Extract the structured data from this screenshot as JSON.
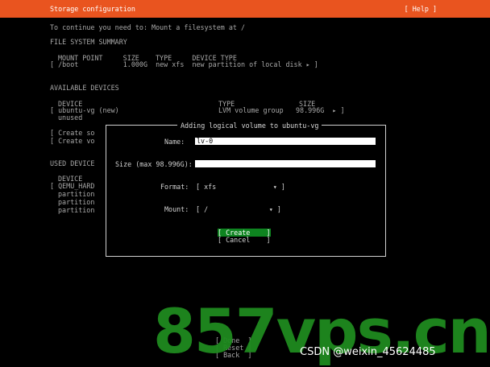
{
  "header": {
    "title": "Storage configuration",
    "help": "[ Help ]"
  },
  "intro": "To continue you need to: Mount a filesystem at /",
  "fs_summary": {
    "heading": "FILE SYSTEM SUMMARY",
    "columns": "MOUNT POINT     SIZE    TYPE     DEVICE TYPE",
    "row": "[ /boot           1.000G  new xfs  new partition of local disk ▸ ]"
  },
  "available": {
    "heading": "AVAILABLE DEVICES",
    "col_device": "DEVICE",
    "col_type": "TYPE",
    "col_size": "SIZE",
    "dev_name": "[ ubuntu-vg (new)",
    "dev_type": "LVM volume group",
    "dev_size": "98.996G  ▸ ]",
    "dev_unused": "unused",
    "create1": "[ Create so",
    "create2": "[ Create vo"
  },
  "used": {
    "heading": "USED DEVICE",
    "col_device": "DEVICE",
    "dev": "[ QEMU_HARD",
    "part1": "partition",
    "part2": "partition",
    "part3": "partition"
  },
  "bottom": {
    "done": "[ Done  ]",
    "reset": "[ Reset ]",
    "back": "[ Back  ]"
  },
  "dialog": {
    "title": "Adding logical volume to ubuntu-vg",
    "name_label": "Name:",
    "name_value": "lv-0",
    "size_label": "Size (max 98.996G):",
    "size_value": "",
    "format_label": "Format:",
    "format_value": "[ xfs              ▾ ]",
    "mount_label": "Mount:",
    "mount_value": "[ /               ▾ ]",
    "create": "[ Create    ]",
    "cancel": "[ Cancel    ]"
  },
  "watermark": "857vps.cn",
  "credit": "CSDN @weixin_45624485",
  "colors": {
    "header": "#e9541f",
    "selected": "#0e8420",
    "watermark": "#1f8b1f"
  }
}
